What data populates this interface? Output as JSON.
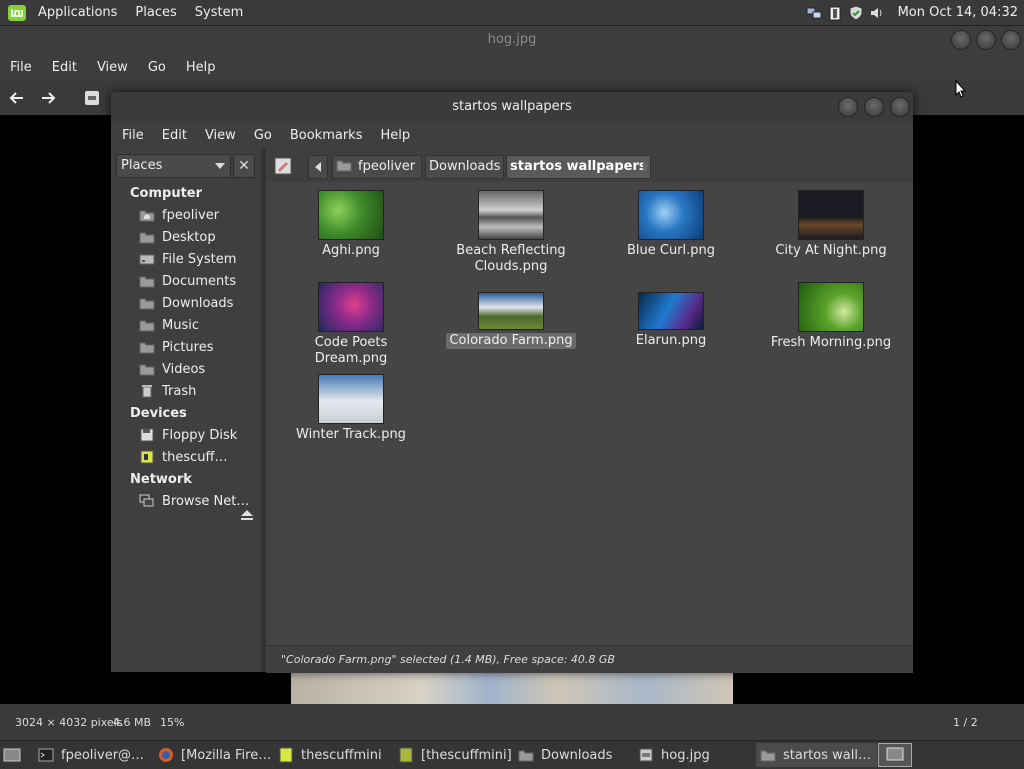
{
  "top_panel": {
    "menu": [
      "Applications",
      "Places",
      "System"
    ],
    "clock": "Mon Oct 14, 04:32",
    "tray_icons": [
      "network-icon",
      "battery-icon",
      "shield-icon",
      "volume-icon"
    ]
  },
  "viewer": {
    "title": "hog.jpg",
    "menu": [
      "File",
      "Edit",
      "View",
      "Go",
      "Help"
    ],
    "status": {
      "dimensions": "3024 × 4032 pixels",
      "size": "4.6 MB",
      "zoom": "15%",
      "position": "1 / 2"
    }
  },
  "file_manager": {
    "title": "startos wallpapers",
    "menu": [
      "File",
      "Edit",
      "View",
      "Go",
      "Bookmarks",
      "Help"
    ],
    "places_label": "Places",
    "sidebar": {
      "computer_heading": "Computer",
      "computer_items": [
        "fpeoliver",
        "Desktop",
        "File System",
        "Documents",
        "Downloads",
        "Music",
        "Pictures",
        "Videos",
        "Trash"
      ],
      "devices_heading": "Devices",
      "devices_items": [
        "Floppy Disk",
        "thescuff…"
      ],
      "network_heading": "Network",
      "network_items": [
        "Browse Net…"
      ]
    },
    "breadcrumbs": [
      "fpeoliver",
      "Downloads",
      "startos wallpapers"
    ],
    "files": [
      {
        "name": "Aghi.png",
        "selected": false
      },
      {
        "name": "Beach Reflecting Clouds.png",
        "selected": false
      },
      {
        "name": "Blue Curl.png",
        "selected": false
      },
      {
        "name": "City At Night.png",
        "selected": false
      },
      {
        "name": "Code Poets Dream.png",
        "selected": false
      },
      {
        "name": "Colorado Farm.png",
        "selected": true
      },
      {
        "name": "Elarun.png",
        "selected": false
      },
      {
        "name": "Fresh Morning.png",
        "selected": false
      },
      {
        "name": "Winter Track.png",
        "selected": false
      }
    ],
    "status": "\"Colorado Farm.png\" selected (1.4 MB), Free space: 40.8 GB"
  },
  "taskbar": {
    "items": [
      "fpeoliver@…",
      "[Mozilla Fire…",
      "thescuffmini",
      "[thescuffmini]",
      "Downloads",
      "hog.jpg",
      "startos wall…"
    ]
  }
}
